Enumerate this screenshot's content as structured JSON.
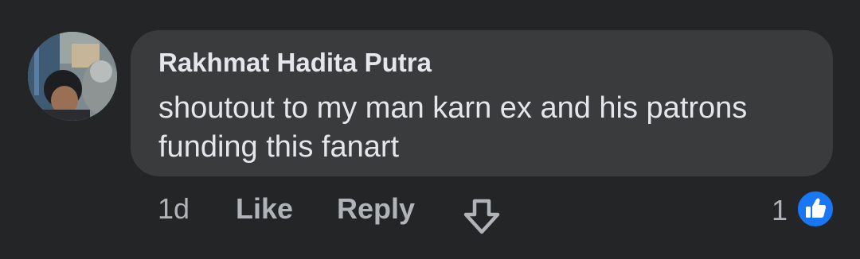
{
  "comment": {
    "author": "Rakhmat Hadita Putra",
    "text": "shoutout to my man karn ex and his patrons funding this fanart",
    "timestamp": "1d",
    "like_label": "Like",
    "reply_label": "Reply",
    "reaction_count": "1",
    "reaction_icon": "like-thumbs-up-icon",
    "downvote_icon": "arrow-down-icon"
  },
  "colors": {
    "background": "#242526",
    "bubble": "#3a3b3c",
    "primary_text": "#e4e6eb",
    "secondary_text": "#b0b3b8",
    "like_blue": "#1877f2"
  }
}
